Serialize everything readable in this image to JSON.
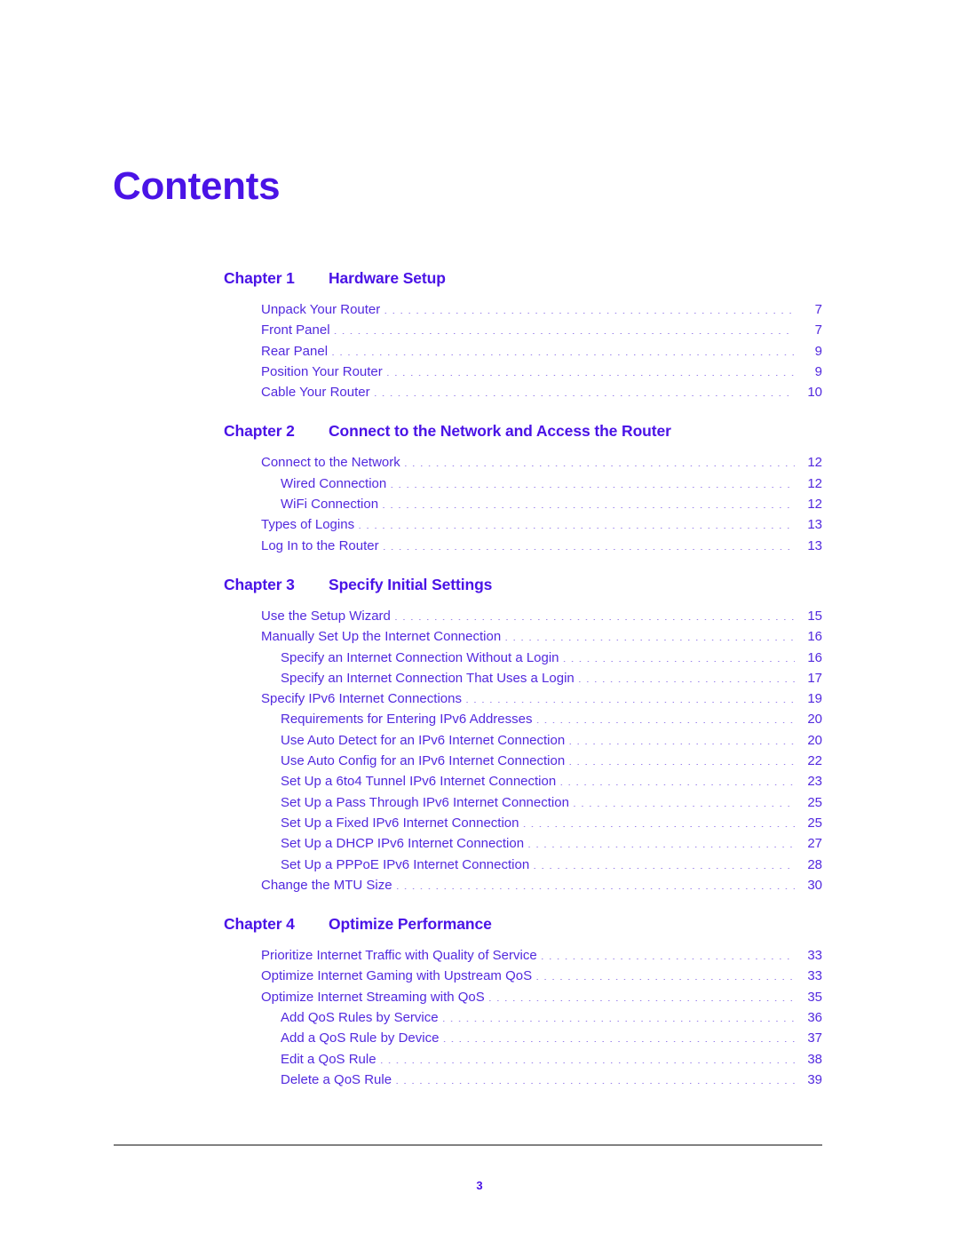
{
  "document": {
    "title": "Contents",
    "page_number": "3"
  },
  "toc": {
    "chapters": [
      {
        "label": "Chapter 1",
        "title": "Hardware Setup",
        "entries": [
          {
            "level": 1,
            "text": "Unpack Your Router",
            "page": "7"
          },
          {
            "level": 1,
            "text": "Front Panel",
            "page": "7"
          },
          {
            "level": 1,
            "text": "Rear Panel",
            "page": "9"
          },
          {
            "level": 1,
            "text": "Position Your Router",
            "page": "9"
          },
          {
            "level": 1,
            "text": "Cable Your Router",
            "page": "10"
          }
        ]
      },
      {
        "label": "Chapter 2",
        "title": "Connect to the Network and Access the Router",
        "entries": [
          {
            "level": 1,
            "text": "Connect to the Network",
            "page": "12"
          },
          {
            "level": 2,
            "text": "Wired Connection",
            "page": "12"
          },
          {
            "level": 2,
            "text": "WiFi Connection",
            "page": "12"
          },
          {
            "level": 1,
            "text": "Types of Logins",
            "page": "13"
          },
          {
            "level": 1,
            "text": "Log In to the Router",
            "page": "13"
          }
        ]
      },
      {
        "label": "Chapter 3",
        "title": "Specify Initial Settings",
        "entries": [
          {
            "level": 1,
            "text": "Use the Setup Wizard",
            "page": "15"
          },
          {
            "level": 1,
            "text": "Manually Set Up the Internet Connection",
            "page": "16"
          },
          {
            "level": 2,
            "text": "Specify an Internet Connection Without a Login",
            "page": "16"
          },
          {
            "level": 2,
            "text": "Specify an Internet Connection That Uses a Login",
            "page": "17"
          },
          {
            "level": 1,
            "text": "Specify IPv6 Internet Connections",
            "page": "19"
          },
          {
            "level": 2,
            "text": "Requirements for Entering IPv6 Addresses",
            "page": "20"
          },
          {
            "level": 2,
            "text": "Use Auto Detect for an IPv6 Internet Connection",
            "page": "20"
          },
          {
            "level": 2,
            "text": "Use Auto Config for an IPv6 Internet Connection",
            "page": "22"
          },
          {
            "level": 2,
            "text": "Set Up a 6to4 Tunnel IPv6 Internet Connection",
            "page": "23"
          },
          {
            "level": 2,
            "text": "Set Up a Pass Through IPv6 Internet Connection",
            "page": "25"
          },
          {
            "level": 2,
            "text": "Set Up a Fixed IPv6 Internet Connection",
            "page": "25"
          },
          {
            "level": 2,
            "text": "Set Up a DHCP IPv6 Internet Connection",
            "page": "27"
          },
          {
            "level": 2,
            "text": "Set Up a PPPoE IPv6 Internet Connection",
            "page": "28"
          },
          {
            "level": 1,
            "text": "Change the MTU Size",
            "page": "30"
          }
        ]
      },
      {
        "label": "Chapter 4",
        "title": "Optimize Performance",
        "entries": [
          {
            "level": 1,
            "text": "Prioritize Internet Traffic with Quality of Service",
            "page": "33"
          },
          {
            "level": 1,
            "text": "Optimize Internet Gaming with Upstream QoS",
            "page": "33"
          },
          {
            "level": 1,
            "text": "Optimize Internet Streaming with QoS",
            "page": "35"
          },
          {
            "level": 2,
            "text": "Add QoS Rules by Service",
            "page": "36"
          },
          {
            "level": 2,
            "text": "Add a QoS Rule by Device",
            "page": "37"
          },
          {
            "level": 2,
            "text": "Edit a QoS Rule",
            "page": "38"
          },
          {
            "level": 2,
            "text": "Delete a QoS Rule",
            "page": "39"
          }
        ]
      }
    ]
  },
  "colors": {
    "heading": "#4A13E6",
    "entry": "#5229DE",
    "rule": "#808080",
    "background": "#FFFFFF"
  }
}
